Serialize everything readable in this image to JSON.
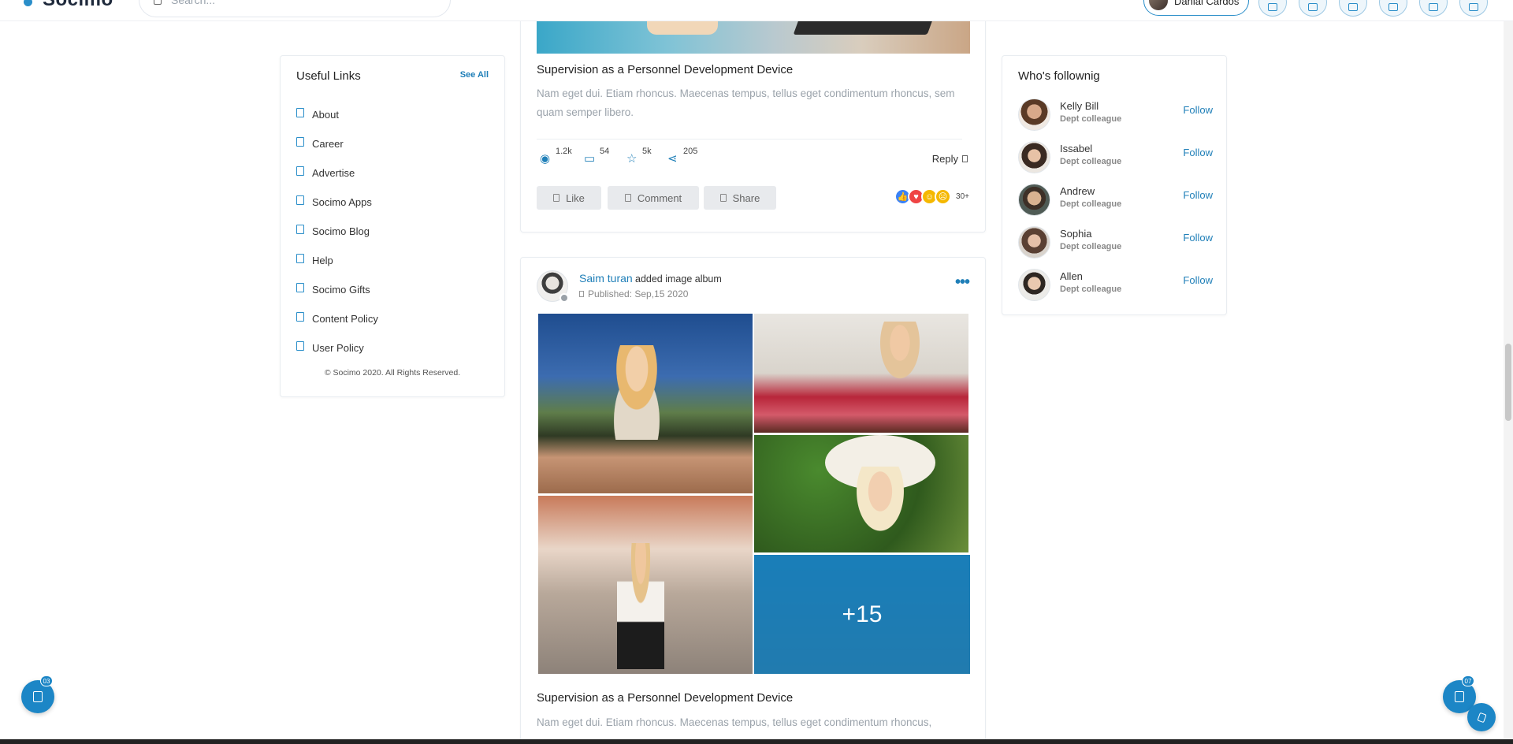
{
  "header": {
    "logo_text": "Socimo",
    "search_placeholder": "Search...",
    "user_name": "Danial Cardos",
    "icon_buttons": [
      "broadcast-icon",
      "home-icon",
      "messages-icon",
      "notifications-icon",
      "add-icon",
      "apps-icon"
    ]
  },
  "useful_links": {
    "title": "Useful Links",
    "see_all": "See All",
    "items": [
      "About",
      "Career",
      "Advertise",
      "Socimo Apps",
      "Socimo Blog",
      "Help",
      "Socimo Gifts",
      "Content Policy",
      "User Policy"
    ],
    "copyright": "© Socimo 2020. All Rights Reserved."
  },
  "post1": {
    "title": "Supervision as a Personnel Development Device",
    "text": "Nam eget dui. Etiam rhoncus. Maecenas tempus, tellus eget condimentum rhoncus, sem quam semper libero.",
    "views": "1.2k",
    "comments": "54",
    "stars": "5k",
    "shares": "205",
    "reply": "Reply",
    "like": "Like",
    "comment": "Comment",
    "share": "Share",
    "reactions_count": "30+"
  },
  "post2": {
    "author": "Saim turan",
    "action": "added image album",
    "published": "Published: Sep,15 2020",
    "more_photos": "+15",
    "title": "Supervision as a Personnel Development Device",
    "text": "Nam eget dui. Etiam rhoncus. Maecenas tempus, tellus eget condimentum rhoncus,"
  },
  "following": {
    "title": "Who's follownig",
    "follow_label": "Follow",
    "people": [
      {
        "name": "Kelly Bill",
        "desc": "Dept colleague"
      },
      {
        "name": "Issabel",
        "desc": "Dept colleague"
      },
      {
        "name": "Andrew",
        "desc": "Dept colleague"
      },
      {
        "name": "Sophia",
        "desc": "Dept colleague"
      },
      {
        "name": "Allen",
        "desc": "Dept colleague"
      }
    ]
  },
  "floating": {
    "left_badge": "03",
    "right_badge": "07"
  },
  "colors": {
    "accent": "#1f7fb8",
    "overlay": "#0e7ebe"
  }
}
